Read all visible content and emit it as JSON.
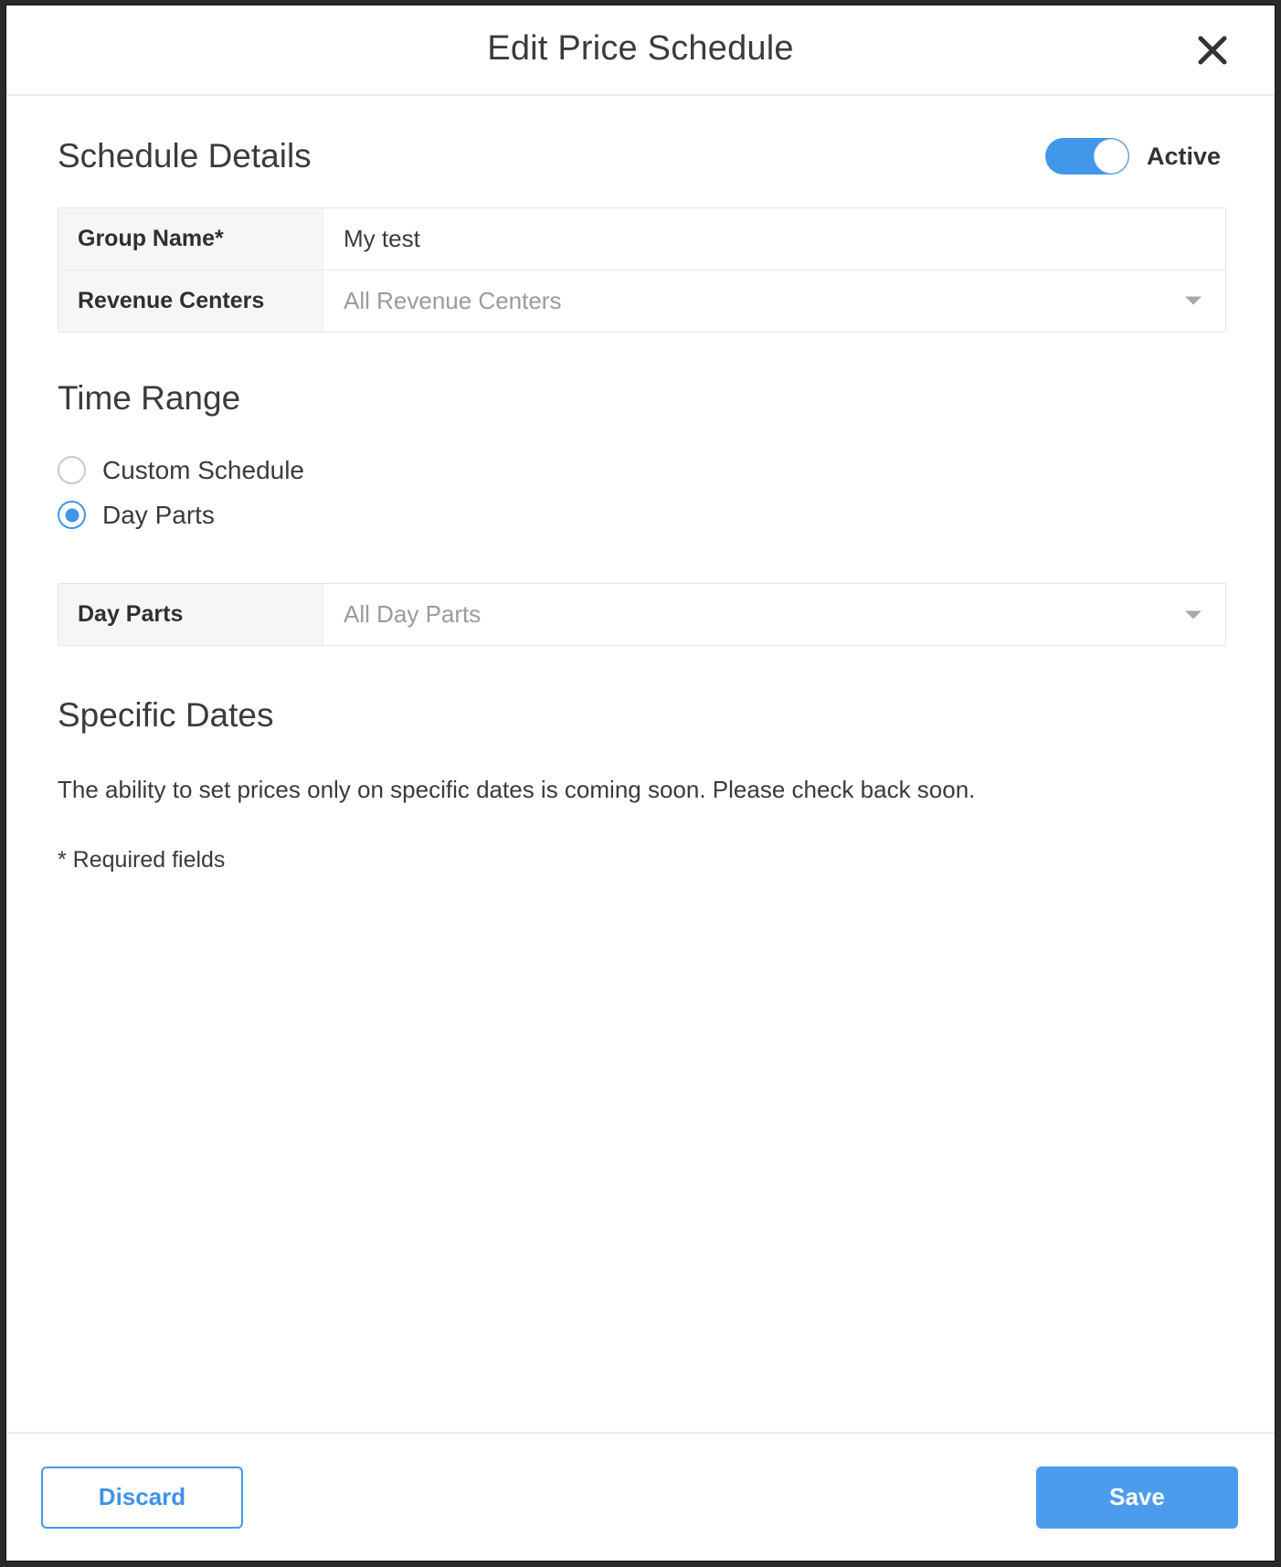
{
  "dialog": {
    "title": "Edit Price Schedule",
    "close_icon": "close-icon"
  },
  "schedule_details": {
    "heading": "Schedule Details",
    "active_toggle": {
      "label": "Active",
      "state": "on",
      "color": "#4397ea"
    },
    "fields": [
      {
        "label": "Group Name*",
        "value": "My test",
        "is_placeholder": false,
        "type": "text"
      },
      {
        "label": "Revenue Centers",
        "value": "All Revenue Centers",
        "is_placeholder": true,
        "type": "select"
      }
    ]
  },
  "time_range": {
    "heading": "Time Range",
    "options": [
      {
        "label": "Custom Schedule",
        "selected": false
      },
      {
        "label": "Day Parts",
        "selected": true
      }
    ],
    "day_parts_field": {
      "label": "Day Parts",
      "value": "All Day Parts",
      "is_placeholder": true,
      "type": "select"
    }
  },
  "specific_dates": {
    "heading": "Specific Dates",
    "message": "The ability to set prices only on specific dates is coming soon. Please check back soon."
  },
  "required_note": "* Required fields",
  "footer": {
    "discard_label": "Discard",
    "save_label": "Save",
    "accent_color": "#4b9ced"
  }
}
